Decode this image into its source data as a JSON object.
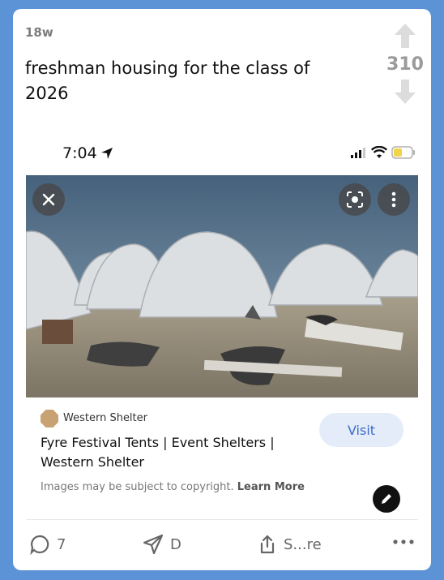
{
  "post": {
    "age": "18w",
    "title": "freshman housing for the class of 2026",
    "vote_count": "310"
  },
  "phone": {
    "time": "7:04"
  },
  "icons": {
    "upvote": "arrow-up-icon",
    "downvote": "arrow-down-icon",
    "location": "location-arrow-icon",
    "signal": "signal-icon",
    "wifi": "wifi-icon",
    "battery": "battery-icon",
    "close": "close-icon",
    "lens": "lens-search-icon",
    "more": "more-vertical-icon",
    "edit": "pencil-icon",
    "comment": "comment-icon",
    "send": "send-icon",
    "share": "share-icon",
    "overflow": "more-horizontal-icon"
  },
  "result": {
    "source_name": "Western Shelter",
    "visit_label": "Visit",
    "title": "Fyre Festival Tents | Event Shelters | Western Shelter",
    "copyright_text": "Images may be subject to copyright.",
    "learn_more": "Learn More"
  },
  "actions": {
    "comments": "7",
    "send_label": "D",
    "share_label": "S...re"
  },
  "colors": {
    "background": "#5b93d6",
    "visit_bg": "#e4ecf9",
    "visit_text": "#3b6cc8",
    "battery_fill": "#f3d34a"
  }
}
